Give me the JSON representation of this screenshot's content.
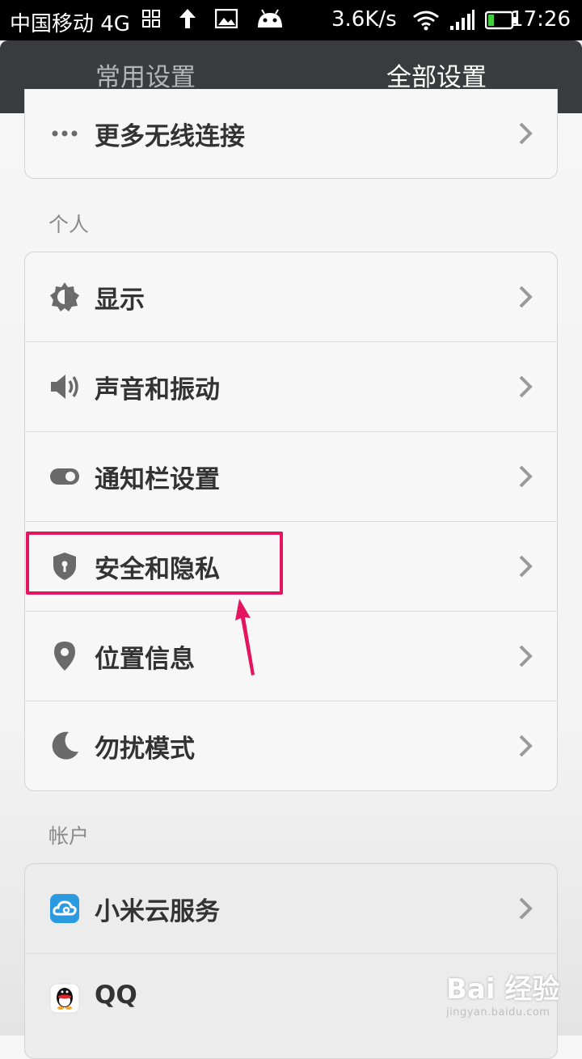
{
  "status_bar": {
    "carrier": "中国移动 4G",
    "speed": "3.6K/s",
    "time": "17:26"
  },
  "tabs": [
    {
      "label": "常用设置",
      "active": false
    },
    {
      "label": "全部设置",
      "active": true
    }
  ],
  "top_group": {
    "items": [
      {
        "label": "更多无线连接",
        "icon": "more-dots-icon"
      }
    ]
  },
  "personal_section": {
    "title": "个人",
    "items": [
      {
        "label": "显示",
        "icon": "brightness-icon"
      },
      {
        "label": "声音和振动",
        "icon": "speaker-icon"
      },
      {
        "label": "通知栏设置",
        "icon": "toggle-icon"
      },
      {
        "label": "安全和隐私",
        "icon": "shield-icon"
      },
      {
        "label": "位置信息",
        "icon": "location-pin-icon"
      },
      {
        "label": "勿扰模式",
        "icon": "moon-icon"
      }
    ]
  },
  "account_section": {
    "title": "帐户",
    "items": [
      {
        "label": "小米云服务",
        "icon": "cloud-icon"
      },
      {
        "label": "QQ",
        "icon": "qq-penguin-icon"
      }
    ]
  },
  "annotation": {
    "highlight_color": "#e5145f",
    "highlighted_item": "安全和隐私"
  },
  "watermark": {
    "main": "Bai 经验",
    "sub": "jingyan.baidu.com"
  },
  "colors": {
    "tabbar_bg": "#3a3b3d",
    "icon_gray": "#6a6a6a",
    "cloud_blue": "#2a9be0"
  }
}
